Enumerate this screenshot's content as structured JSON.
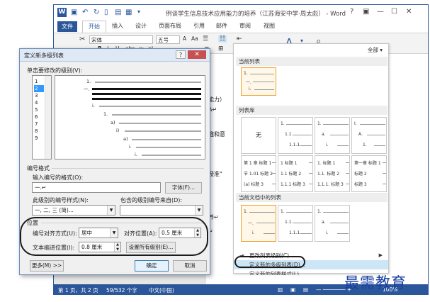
{
  "word": {
    "doc_title": "例谈学生信息技术应用能力的培养（江苏海安中学·周太彪） - Word",
    "win_controls": [
      "?",
      "▣",
      "—",
      "☐",
      "✕"
    ],
    "tabs": [
      "文件",
      "开始",
      "插入",
      "设计",
      "页面布局",
      "引用",
      "邮件",
      "审阅",
      "视图"
    ],
    "ribbon": {
      "font_name": "宋体",
      "font_size": "五号",
      "format_buttons": [
        "B",
        "I",
        "U",
        "abc",
        "x₂",
        "x²"
      ],
      "all_label": "全部 ▾"
    },
    "doc_fragments": [
      "能力）",
      "A↵",
      "趣和意",
      "授准\"",
      "养↵",
      "↵"
    ],
    "status": {
      "page": "第 1 页，共 2 页",
      "words": "59/532 个字",
      "lang": "中文(中国)",
      "zoom": "100%"
    }
  },
  "gallery": {
    "section_current": "当前列表",
    "section_library": "列表库",
    "section_doc": "当前文档中的列表",
    "none_label": "无",
    "current_tile": [
      "1.",
      "一.",
      "i."
    ],
    "library_tiles": [
      [
        "1.",
        "1.1.",
        "1.1.1."
      ],
      [
        "1.",
        "1.1.",
        "1.1.1."
      ],
      [
        "1.",
        "a.",
        "i."
      ],
      [
        "I.",
        "A.",
        "1."
      ],
      [
        "第 1 章 标题 1",
        "节 1.01 标题 2",
        "(a) 标题 3"
      ],
      [
        "1 标题 1",
        "1.1 标题 2",
        "1.1.1 标题 3"
      ],
      [
        "1. 标题 1",
        "1.1. 标题 2",
        "1.1.1. 标题 3"
      ],
      [
        "第一章 标题 1",
        "标题 2",
        "标题 3"
      ]
    ],
    "doc_tiles": [
      [
        "1.",
        "一.",
        "i."
      ],
      [
        "1.",
        "1.1.",
        "1.1.1."
      ],
      [
        "1.",
        "a.",
        "i."
      ]
    ],
    "menu": {
      "change_level": "更改列表级别(C)",
      "define_multilevel": "定义新的多级列表(D)...",
      "define_style": "定义新的列表样式(L)..."
    }
  },
  "dialog": {
    "title": "定义新多级列表",
    "help": "?",
    "close": "✕",
    "level_label": "单击要修改的级别(V):",
    "levels": [
      "1",
      "2",
      "3",
      "4",
      "5",
      "6",
      "7",
      "8",
      "9"
    ],
    "selected_level": "2",
    "preview_items": [
      "1.",
      "一.",
      "i.",
      "1.",
      "a)",
      "i)",
      "a)",
      "i.",
      "i."
    ],
    "number_format_heading": "编号格式",
    "enter_format_label": "输入编号的格式(O):",
    "enter_format_value": "一.↵",
    "font_button": "字体(F)...",
    "style_label": "此级别的编号样式(N):",
    "style_value": "一, 二, 三 (简)...",
    "include_label": "包含的级别编号来自(D):",
    "include_value": "",
    "position_heading": "位置",
    "align_label": "编号对齐方式(U):",
    "align_value": "居中",
    "align_at_label": "对齐位置(A):",
    "align_at_value": "0.5 厘米",
    "indent_label": "文本缩进位置(I):",
    "indent_value": "0.8 厘米",
    "set_all_button": "设置所有级别(E)...",
    "more_button": "更多(M) >>",
    "ok_button": "确定",
    "cancel_button": "取消"
  },
  "watermark": "最需教育",
  "colors": {
    "word_blue": "#2b579a",
    "selection": "#3399ff",
    "menu_highlight": "#cde6f7",
    "watermark": "#1a3fa3"
  }
}
